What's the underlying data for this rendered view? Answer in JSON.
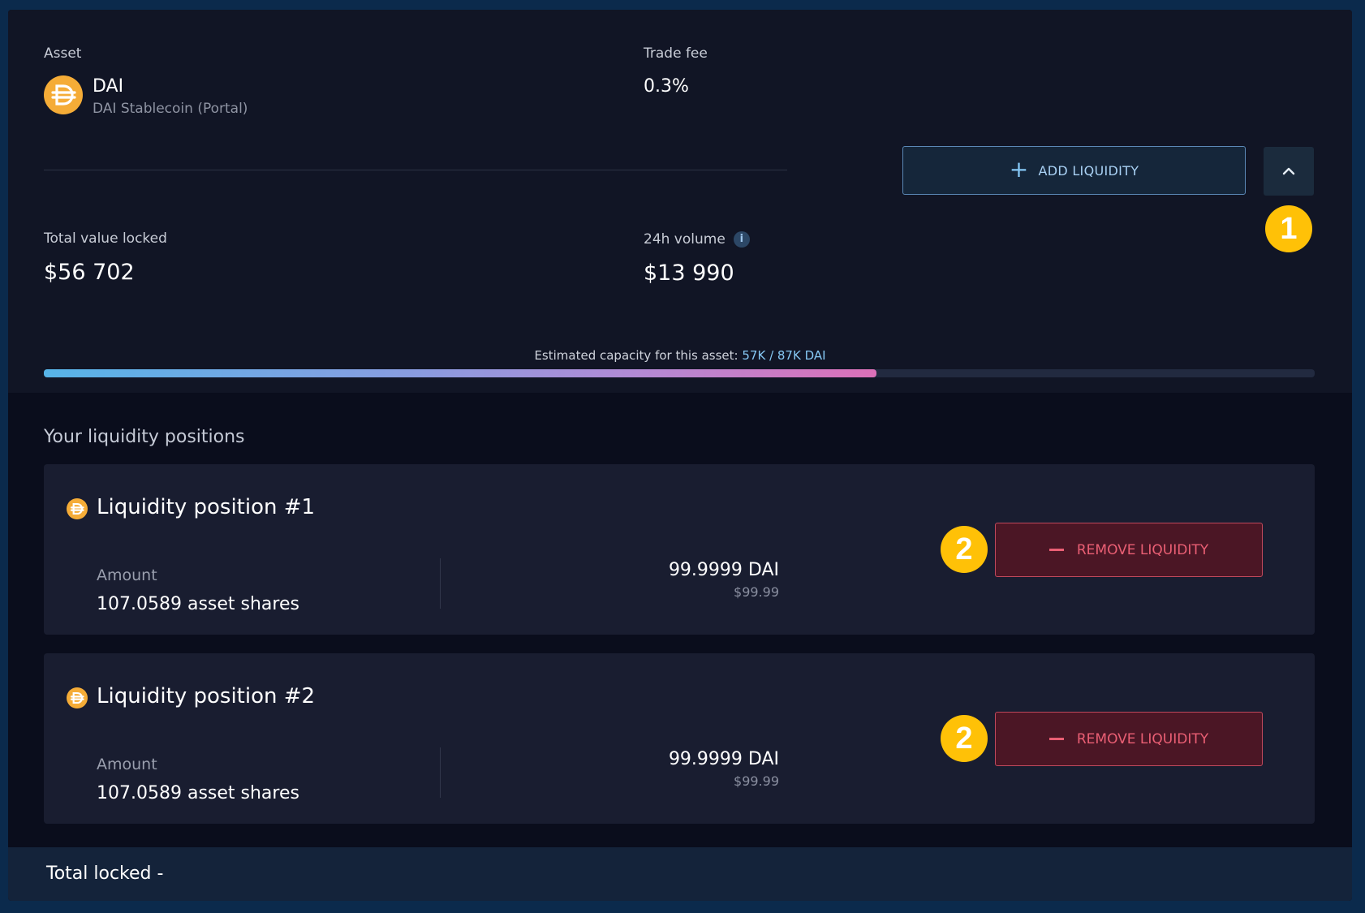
{
  "asset": {
    "label": "Asset",
    "symbol": "DAI",
    "name": "DAI Stablecoin (Portal)",
    "icon": "dai-icon",
    "icon_color": "#f5ac37"
  },
  "trade_fee": {
    "label": "Trade fee",
    "value": "0.3%"
  },
  "actions": {
    "add_liquidity_label": "ADD LIQUIDITY",
    "collapse_icon": "chevron-up-icon"
  },
  "stats": {
    "tvl_label": "Total value locked",
    "tvl_value": "$56 702",
    "volume_label": "24h volume",
    "volume_value": "$13 990",
    "info_glyph": "i"
  },
  "capacity": {
    "label": "Estimated capacity for this asset:",
    "value": "57K / 87K DAI",
    "fill_fraction": 0.655
  },
  "badges": {
    "one": "1",
    "two": "2",
    "badge_color": "#ffc107"
  },
  "positions_title": "Your liquidity positions",
  "positions": [
    {
      "title": "Liquidity position #1",
      "amount_label": "Amount",
      "shares": "107.0589 asset shares",
      "token_amount": "99.9999 DAI",
      "usd_amount": "$99.99",
      "remove_label": "REMOVE LIQUIDITY"
    },
    {
      "title": "Liquidity position #2",
      "amount_label": "Amount",
      "shares": "107.0589 asset shares",
      "token_amount": "99.9999 DAI",
      "usd_amount": "$99.99",
      "remove_label": "REMOVE LIQUIDITY"
    }
  ],
  "footer": {
    "total_locked": "Total locked -"
  }
}
